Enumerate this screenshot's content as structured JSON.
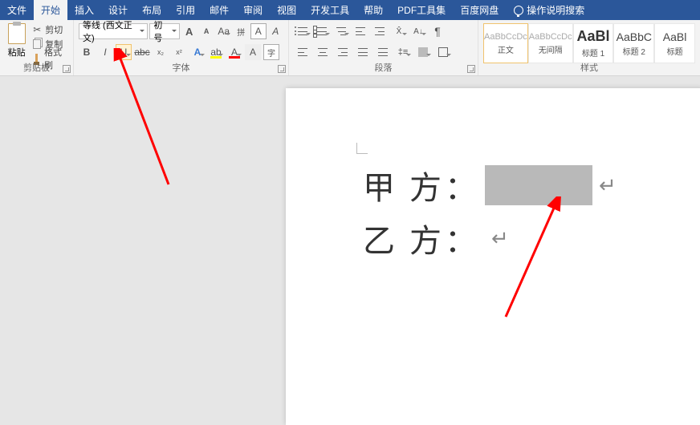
{
  "tabs": {
    "file": "文件",
    "home": "开始",
    "insert": "插入",
    "design": "设计",
    "layout": "布局",
    "references": "引用",
    "mailings": "邮件",
    "review": "审阅",
    "view": "视图",
    "devtools": "开发工具",
    "help": "帮助",
    "pdf": "PDF工具集",
    "baidu": "百度网盘",
    "tellme": "操作说明搜索"
  },
  "clipboard": {
    "paste": "粘贴",
    "cut": "剪切",
    "copy": "复制",
    "format_painter": "格式刷",
    "group": "剪贴板"
  },
  "font": {
    "family": "等线 (西文正文)",
    "size": "初号",
    "group": "字体",
    "bold": "B",
    "italic": "I",
    "underline": "U",
    "strike": "abc",
    "sub": "x₂",
    "sup": "x²",
    "growA": "A",
    "shrinkA": "A",
    "caseA": "Aa",
    "clear": "A",
    "phonetic": "拼",
    "charBorder": "A",
    "effects": "A",
    "highlight": "ab",
    "fontcolor": "A",
    "charshade": "A",
    "enclose": "字"
  },
  "paragraph": {
    "group": "段落"
  },
  "styles": {
    "group": "样式",
    "items": [
      {
        "preview": "AaBbCcDc",
        "name": "正文"
      },
      {
        "preview": "AaBbCcDc",
        "name": "无间隔"
      },
      {
        "preview": "AaBl",
        "name": "标题 1"
      },
      {
        "preview": "AaBbC",
        "name": "标题 2"
      },
      {
        "preview": "AaBl",
        "name": "标题"
      }
    ]
  },
  "document": {
    "line1_label": "甲",
    "line1_label2": "方",
    "colon": "：",
    "line2_label": "乙",
    "line2_label2": "方",
    "return": "↵"
  }
}
